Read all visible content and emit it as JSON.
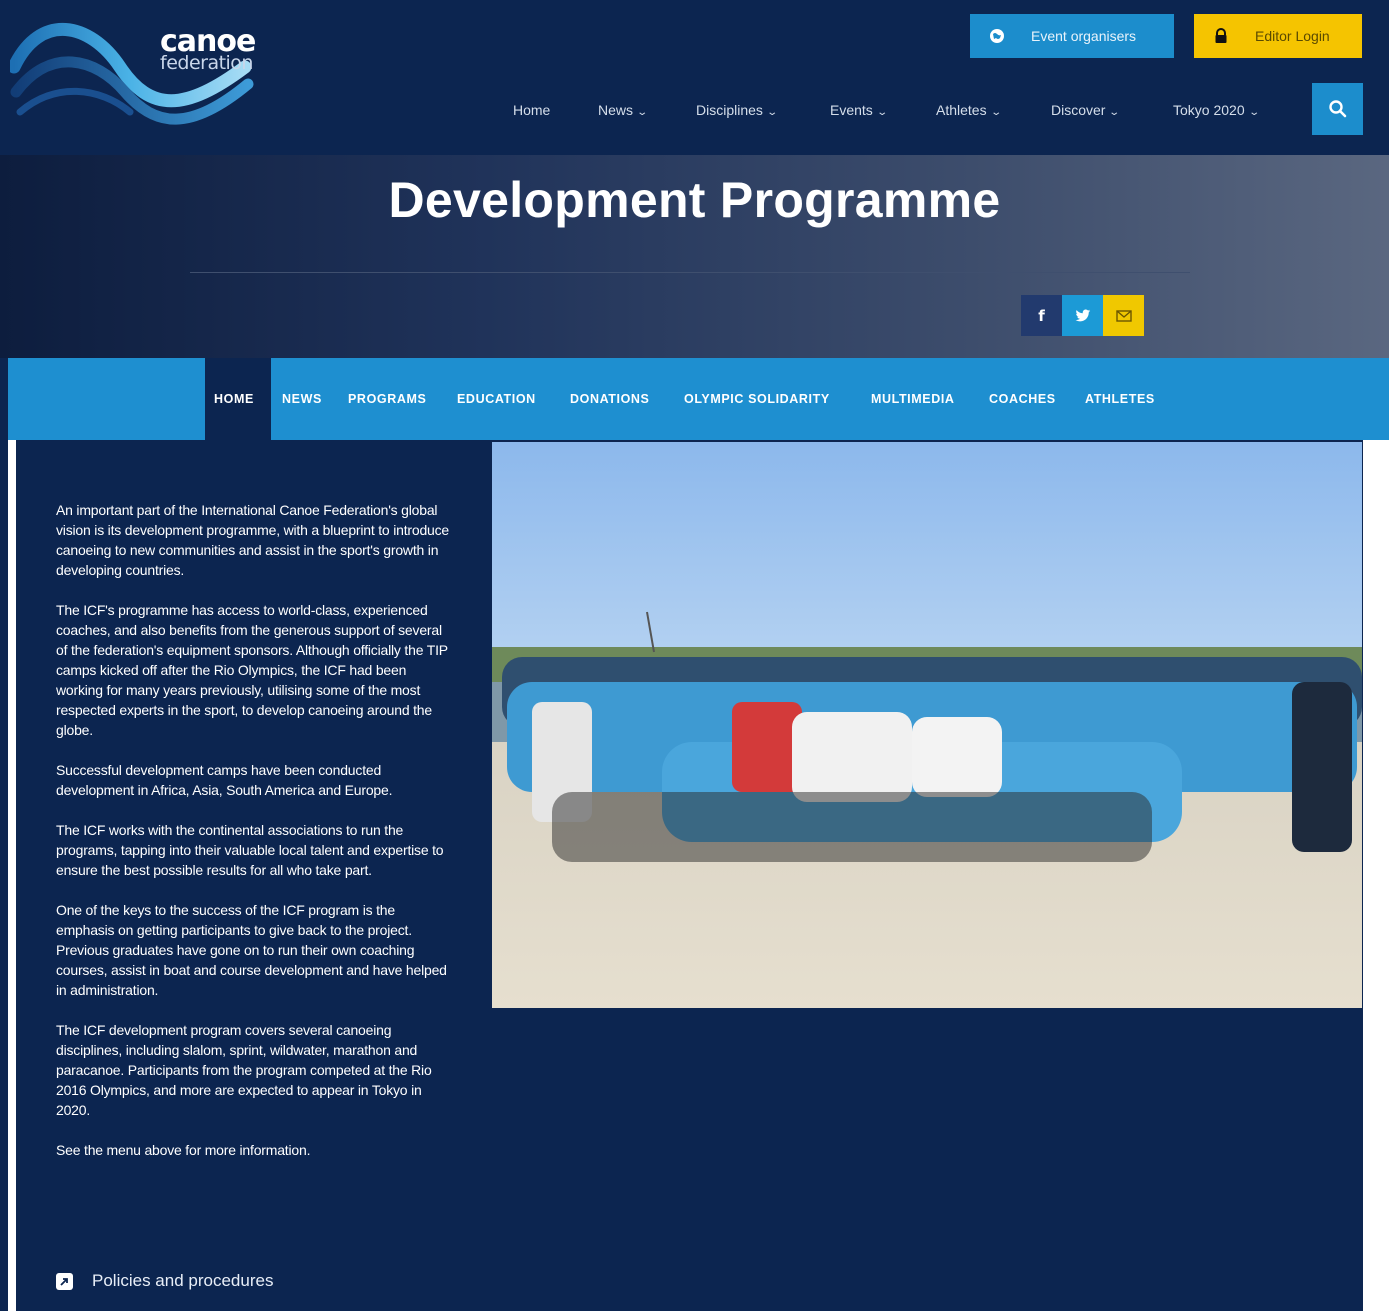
{
  "logo": {
    "line1": "canoe",
    "line2": "federation"
  },
  "top_buttons": {
    "organisers": {
      "label": "Event organisers",
      "icon": "globe-icon"
    },
    "login": {
      "label": "Editor Login",
      "icon": "lock-icon"
    }
  },
  "main_nav": {
    "items": [
      {
        "label": "Home",
        "dropdown": false
      },
      {
        "label": "News",
        "dropdown": true
      },
      {
        "label": "Disciplines",
        "dropdown": true
      },
      {
        "label": "Events",
        "dropdown": true
      },
      {
        "label": "Athletes",
        "dropdown": true
      },
      {
        "label": "Discover",
        "dropdown": true
      },
      {
        "label": "Tokyo 2020",
        "dropdown": true
      }
    ],
    "chevron": "⌄",
    "search_icon": "search-icon"
  },
  "hero": {
    "title": "Development Programme",
    "share": {
      "facebook": "f",
      "twitter_icon": "twitter-icon",
      "email_icon": "email-icon"
    }
  },
  "sub_nav": {
    "items": [
      "HOME",
      "NEWS",
      "PROGRAMS",
      "EDUCATION",
      "DONATIONS",
      "OLYMPIC SOLIDARITY",
      "MULTIMEDIA",
      "COACHES",
      "ATHLETES"
    ],
    "active": "HOME"
  },
  "article": {
    "paragraphs": [
      "An important part of the International Canoe Federation's global vision is its development programme, with a blueprint to introduce canoeing to new communities and assist in the sport's growth in developing countries.",
      "The ICF's programme has access to world-class, experienced coaches, and also benefits from the generous support of several of the federation's equipment sponsors. Although officially the TIP camps kicked off after the Rio Olympics, the ICF had been working for many years previously, utilising some of the most respected experts in the sport, to develop canoeing around the globe.",
      "Successful development camps have been conducted development in Africa, Asia, South America and Europe.",
      "The ICF works with the continental associations to run the programs, tapping into their valuable local talent and expertise to ensure the best possible results for all who take part.",
      "One of the keys to the success of the ICF program is the emphasis on getting participants to give back to the project. Previous graduates have gone on to run their own coaching courses, assist in boat and course development and have helped in administration.",
      "The ICF development program covers several canoeing disciplines, including slalom, sprint, wildwater, marathon and paracanoe. Participants from the program competed at the Rio 2016 Olympics, and more are expected to appear in Tokyo in 2020.",
      "See the menu above for more information."
    ],
    "policies_link": "Policies and procedures"
  },
  "colors": {
    "navy": "#0c2550",
    "accent_blue": "#1e8fd0",
    "yellow": "#f5c400"
  }
}
